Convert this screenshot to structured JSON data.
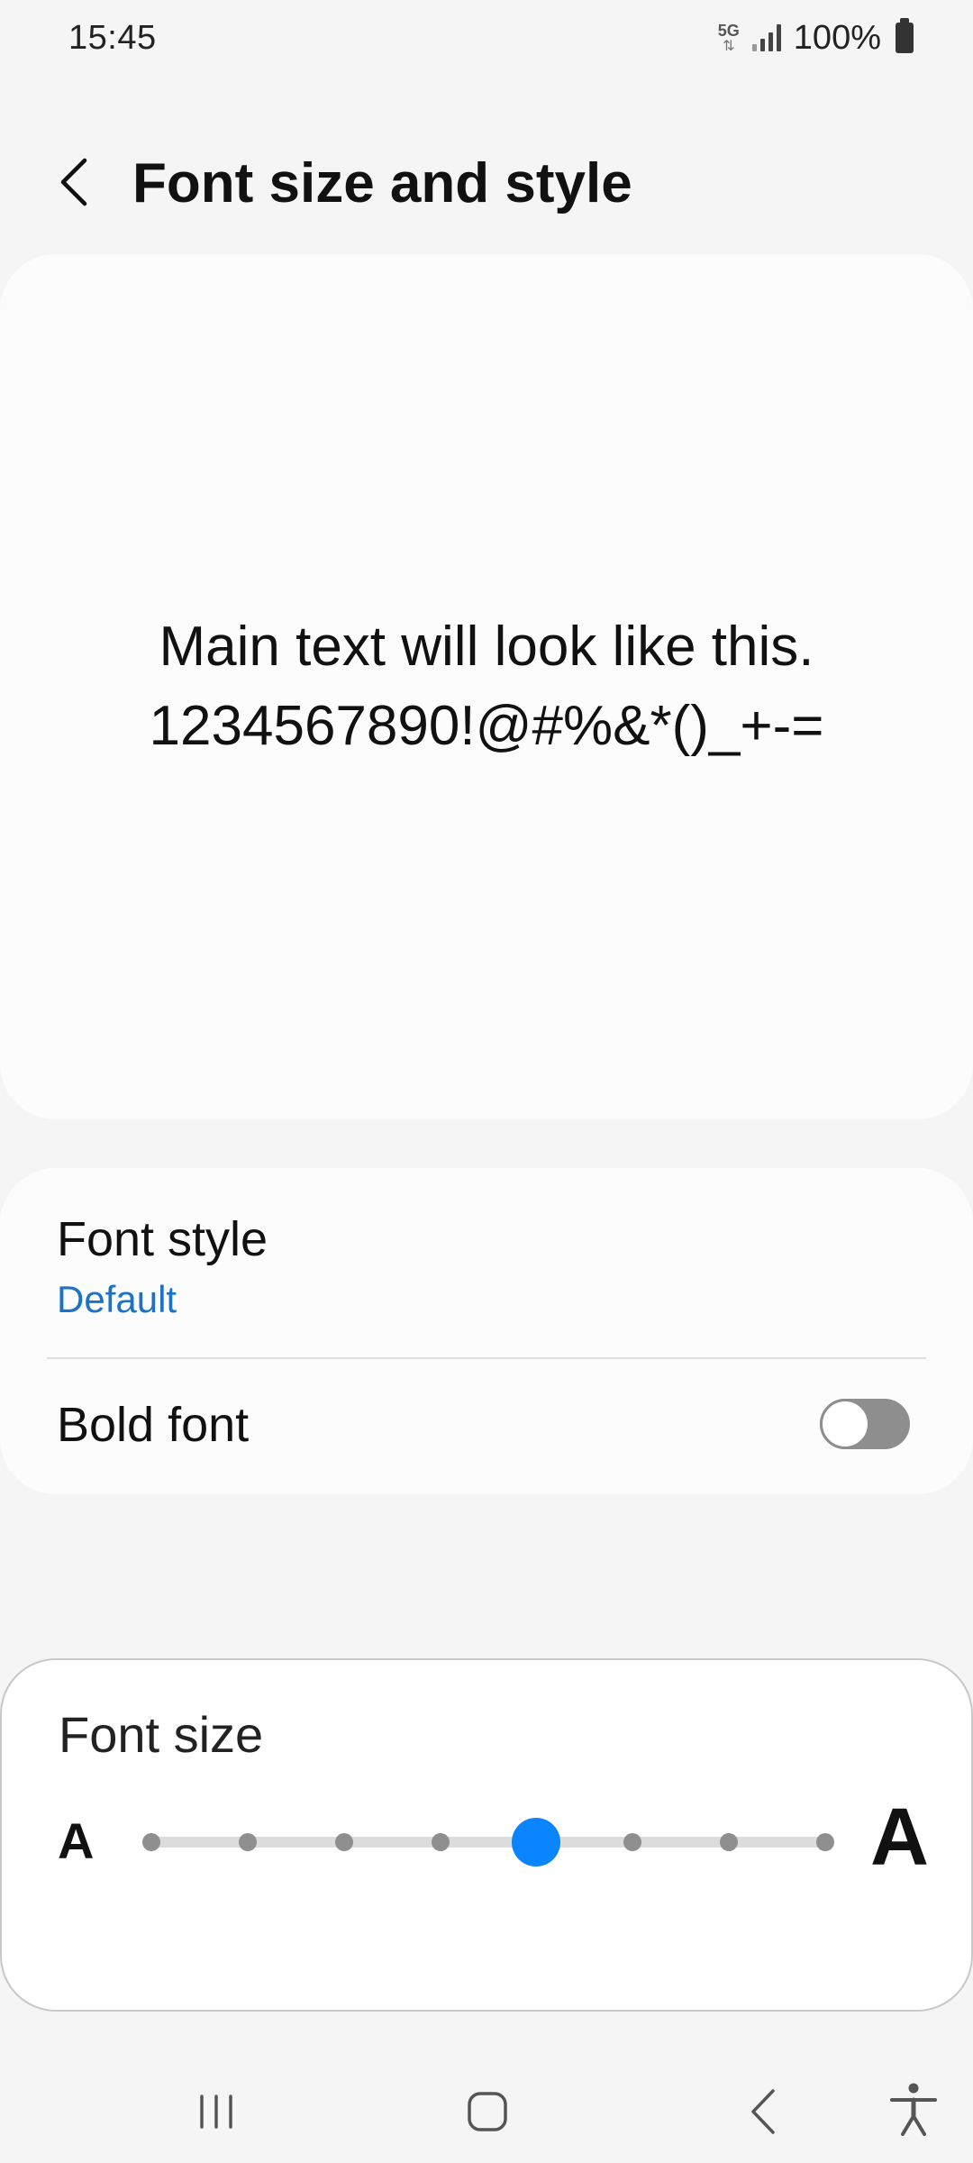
{
  "status_bar": {
    "time": "15:45",
    "network": "5G",
    "battery_percent": "100%"
  },
  "header": {
    "title": "Font size and style",
    "back_icon": "chevron-left-icon"
  },
  "preview": {
    "line1": "Main text will look like this.",
    "line2": "1234567890!@#%&*()_+-="
  },
  "settings": {
    "font_style": {
      "label": "Font style",
      "value": "Default"
    },
    "bold_font": {
      "label": "Bold font",
      "enabled": false
    }
  },
  "font_size": {
    "label": "Font size",
    "small_glyph": "A",
    "large_glyph": "A",
    "steps": 8,
    "selected_step": 5
  },
  "colors": {
    "accent": "#0a84ff",
    "link": "#1a73c9",
    "background": "#f5f5f5",
    "card": "#fcfcfc"
  },
  "nav_bar": {
    "icons": [
      "recents-icon",
      "home-icon",
      "back-icon",
      "accessibility-icon"
    ]
  }
}
